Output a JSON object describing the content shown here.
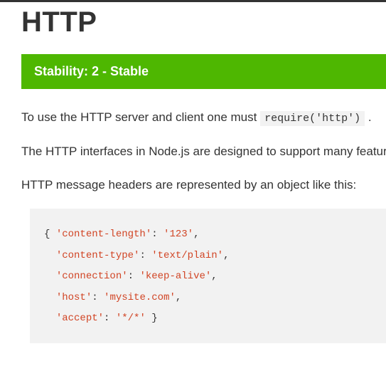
{
  "page": {
    "title": "HTTP",
    "stability_banner": "Stability: 2 - Stable",
    "intro_prefix": "To use the HTTP server and client one must ",
    "intro_code": "require('http')",
    "intro_suffix": " .",
    "para2": "The HTTP interfaces in Node.js are designed to support many features of the protocol which have been traditionally difficult to use. In particular, large, possibly chunk-encoded, messages. The interface is careful to never buffer entire requests or responses — the user is able to stream data.",
    "para3": "HTTP message headers are represented by an object like this:"
  },
  "code": {
    "headers_example": {
      "pairs": [
        {
          "k": "'content-length'",
          "v": "'123'"
        },
        {
          "k": "'content-type'",
          "v": "'text/plain'"
        },
        {
          "k": "'connection'",
          "v": "'keep-alive'"
        },
        {
          "k": "'host'",
          "v": "'mysite.com'"
        },
        {
          "k": "'accept'",
          "v": "'*/*'"
        }
      ]
    }
  }
}
